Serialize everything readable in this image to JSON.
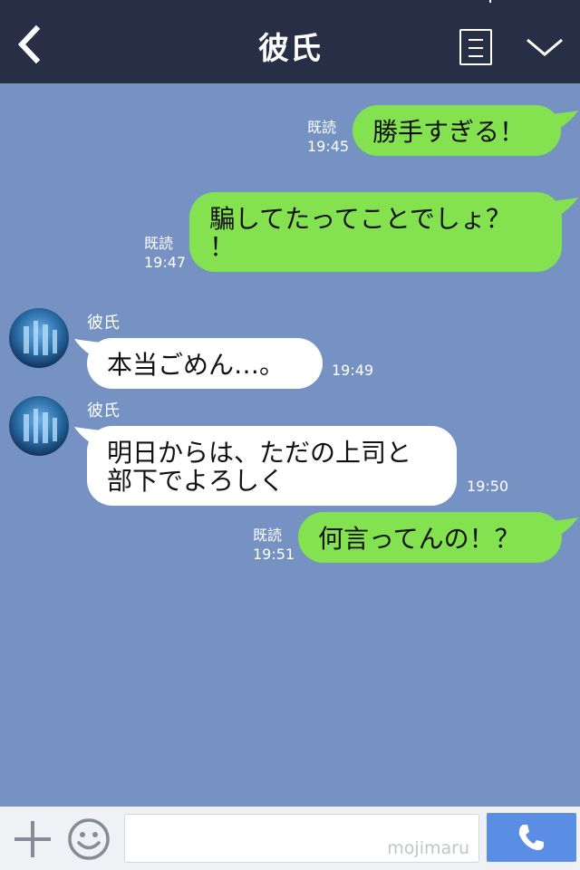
{
  "header": {
    "title": "彼氏"
  },
  "messages": [
    {
      "side": "out",
      "text": "勝手すぎる！",
      "read": "既読",
      "time": "19:45"
    },
    {
      "side": "out",
      "line1": "騙してたってことでしょ？",
      "line2": "！",
      "read": "既読",
      "time": "19:47"
    },
    {
      "side": "in",
      "sender": "彼氏",
      "text": "本当ごめん…。",
      "time": "19:49"
    },
    {
      "side": "in",
      "sender": "彼氏",
      "line1": "明日からは、ただの上司と",
      "line2": "部下でよろしく",
      "time": "19:50"
    },
    {
      "side": "out",
      "text": "何言ってんの！？",
      "read": "既読",
      "time": "19:51"
    }
  ],
  "footer": {
    "input_value": "",
    "watermark": "mojimaru"
  },
  "colors": {
    "header_bg": "#262f45",
    "chat_bg": "#7592c2",
    "out_bubble": "#84e150",
    "in_bubble": "#ffffff",
    "call_button": "#5a8de4"
  },
  "icons": {
    "back": "chevron-left-icon",
    "menu": "note-icon",
    "collapse": "chevron-down-icon",
    "add": "plus-icon",
    "emoji": "smiley-icon",
    "call": "phone-icon"
  }
}
